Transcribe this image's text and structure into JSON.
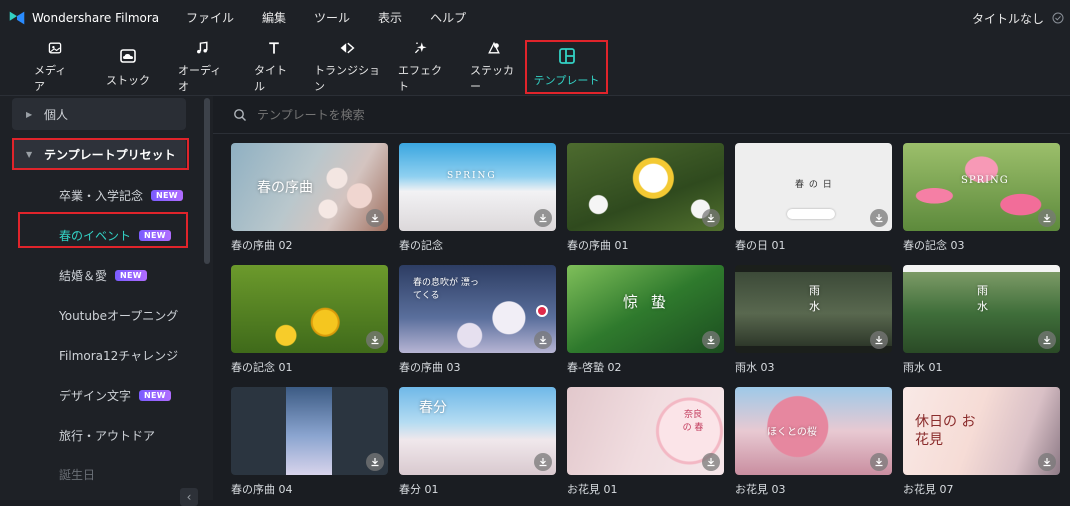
{
  "app": {
    "name": "Wondershare Filmora",
    "doc_title": "タイトルなし"
  },
  "menu": [
    "ファイル",
    "編集",
    "ツール",
    "表示",
    "ヘルプ"
  ],
  "toolbar": {
    "media": "メディア",
    "stock": "ストック",
    "audio": "オーディオ",
    "title": "タイトル",
    "transition": "トランジション",
    "effect": "エフェクト",
    "sticker": "ステッカー",
    "template": "テンプレート"
  },
  "sidebar": {
    "personal": "個人",
    "presets": "テンプレートプリセット",
    "items": [
      "卒業・入学記念",
      "春のイベント",
      "結婚＆愛",
      "Youtubeオープニング",
      "Filmora12チャレンジ",
      "デザイン文字",
      "旅行・アウトドア",
      "誕生日"
    ],
    "new_badge": "NEW"
  },
  "search": {
    "placeholder": "テンプレートを検索"
  },
  "templates": [
    {
      "label": "春の序曲 02",
      "text": "春の序曲"
    },
    {
      "label": "春の記念",
      "text": "SPRING"
    },
    {
      "label": "春の序曲 01",
      "text": ""
    },
    {
      "label": "春の日 01",
      "text": "春 の 日"
    },
    {
      "label": "春の記念 03",
      "text": "SPRING"
    },
    {
      "label": "春の記念 01",
      "text": ""
    },
    {
      "label": "春の序曲 03",
      "text": "春の息吹が 漂ってくる"
    },
    {
      "label": "春-啓蟄 02",
      "text": "惊 蛰"
    },
    {
      "label": "雨水 03",
      "text": "雨 水"
    },
    {
      "label": "雨水 01",
      "text": "雨 水"
    },
    {
      "label": "春の序曲 04",
      "text": ""
    },
    {
      "label": "春分 01",
      "text": "春分"
    },
    {
      "label": "お花見 01",
      "text": "奈良 の 春"
    },
    {
      "label": "お花見 03",
      "text": "ほくとの桜"
    },
    {
      "label": "お花見 07",
      "text": "休日の お花見"
    }
  ],
  "colors": {
    "accent": "#33d1c4",
    "highlight_box": "#e0242b",
    "new_badge": "#9a63ff"
  }
}
